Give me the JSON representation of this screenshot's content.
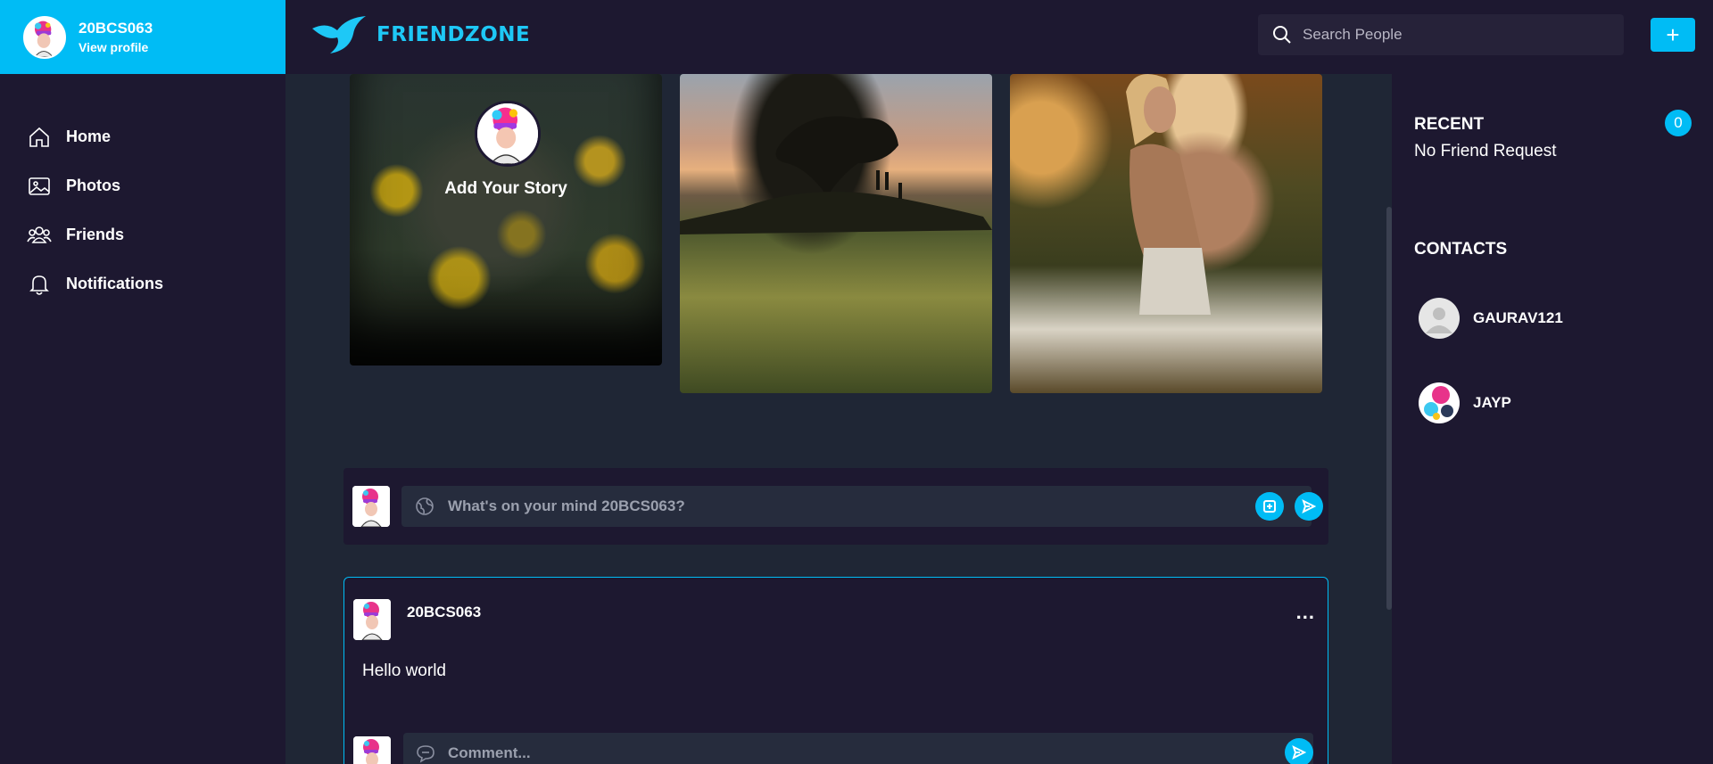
{
  "profile": {
    "name": "20BCS063",
    "link_label": "View profile"
  },
  "brand": {
    "name": "FRIENDZONE",
    "accent": "#00bcf5"
  },
  "nav": {
    "items": [
      {
        "label": "Home",
        "icon": "home-icon"
      },
      {
        "label": "Photos",
        "icon": "image-icon"
      },
      {
        "label": "Friends",
        "icon": "users-icon"
      },
      {
        "label": "Notifications",
        "icon": "bell-icon"
      }
    ]
  },
  "search": {
    "placeholder": "Search People"
  },
  "header": {
    "add_label": "+"
  },
  "stories": {
    "add_label": "Add Your Story"
  },
  "composer": {
    "placeholder": "What's on your mind 20BCS063?"
  },
  "post": {
    "author": "20BCS063",
    "menu_label": "...",
    "text": "Hello world",
    "comment_placeholder": "Comment..."
  },
  "right": {
    "recent_title": "RECENT",
    "recent_empty": "No Friend Request",
    "request_count": "0",
    "contacts_title": "CONTACTS",
    "contacts": [
      {
        "name": "GAURAV121"
      },
      {
        "name": "JAYP"
      }
    ]
  }
}
